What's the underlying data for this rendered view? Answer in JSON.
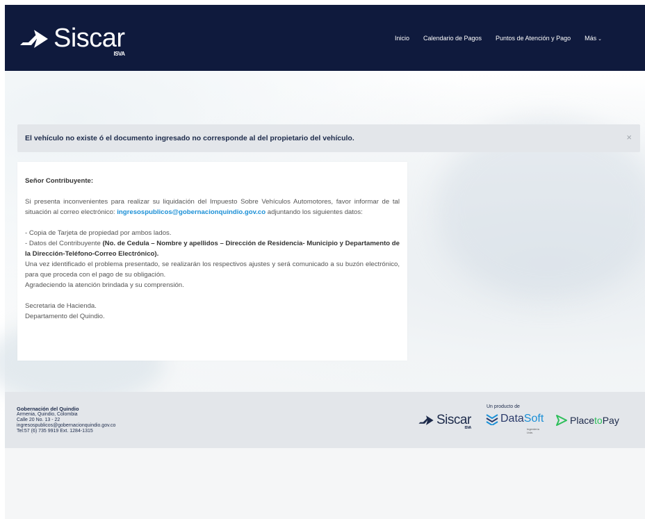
{
  "header": {
    "logo_text": "Siscar",
    "logo_sub": "ISVA",
    "nav": [
      {
        "label": "Inicio"
      },
      {
        "label": "Calendario de Pagos"
      },
      {
        "label": "Puntos de Atención y Pago"
      },
      {
        "label": "Más"
      }
    ]
  },
  "alert": {
    "message": "El vehículo no existe ó el documento ingresado no corresponde al del propietario del vehículo.",
    "close": "×"
  },
  "card": {
    "salutation": "Señor Contribuyente:",
    "p1_start": "Si presenta inconvenientes para realizar su liquidación del Impuesto Sobre Vehículos Automotores, favor informar de tal situación al correo electrónico: ",
    "email": "ingresospublicos@gobernacionquindio.gov.co",
    "p1_end": " adjuntando los siguientes datos:",
    "item1": "- Copia de Tarjeta de propiedad por ambos lados.",
    "item2_start": "- Datos del Contribuyente ",
    "item2_bold": "(No. de Cedula – Nombre y apellidos – Dirección de Residencia- Municipio y Departamento de la Dirección-Teléfono-Correo Electrónico).",
    "line3": "Una vez identificado el problema presentado, se realizarán los respectivos ajustes y será comunicado a su buzón electrónico, para que proceda con el pago de su obligación.",
    "line4": "Agradeciendo la atención brindada y su comprensión.",
    "sign1": "Secretaria de Hacienda.",
    "sign2": "Departamento del Quindio."
  },
  "footer": {
    "org": "Gobernación del Quindio",
    "city": "Armenia, Quindio, Colombia",
    "address": "Calle 20 No. 13 - 22",
    "email": "ingresospublicos@gobernacionquindio.gov.co",
    "phone": "Tel:57 (6) 735 9919 Ext. 1284-1315",
    "producto_label": "Un producto de",
    "logo_siscar": "Siscar",
    "logo_siscar_sub": "ISVA",
    "logo_datasoft_data": "Data",
    "logo_datasoft_soft": "Soft",
    "logo_datasoft_sub": "Ingeniería Ltda.",
    "logo_ptp_place": "Place",
    "logo_ptp_to": "to",
    "logo_ptp_pay": "Pay"
  },
  "colors": {
    "navy": "#0f1a3d",
    "link": "#1a8fd6",
    "alert_bg": "#e3e6ea",
    "ptp_green": "#2dbf5a"
  }
}
